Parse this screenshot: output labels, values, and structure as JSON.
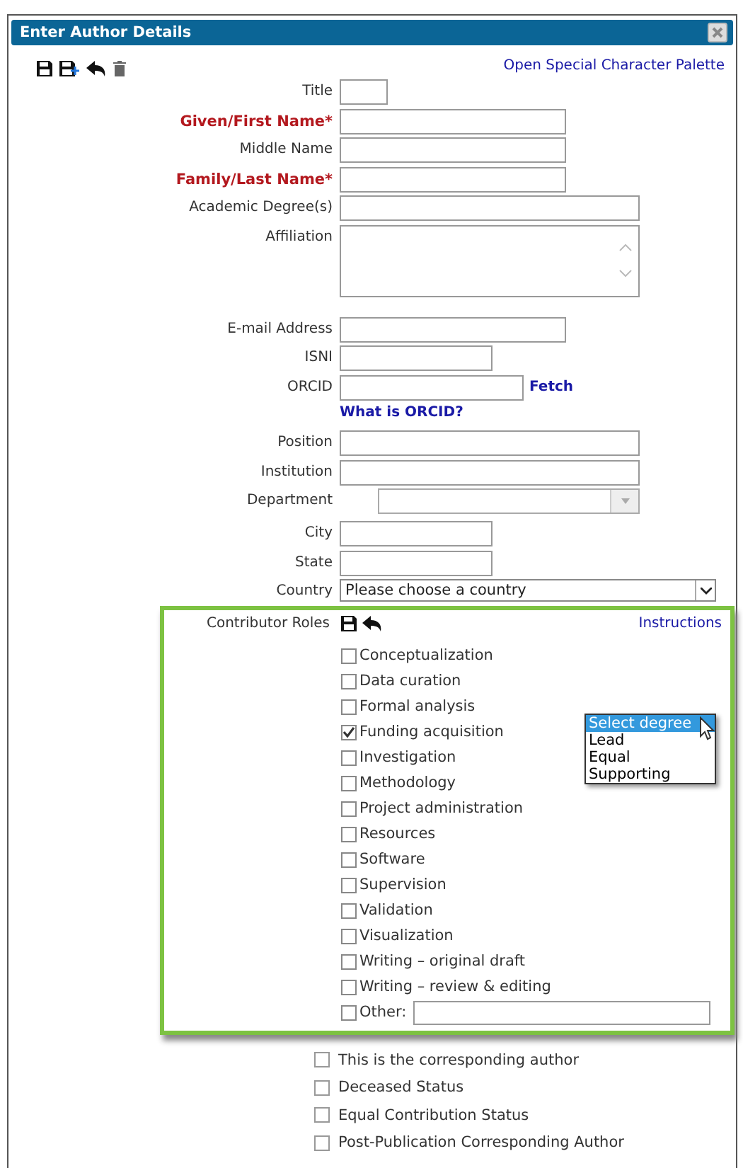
{
  "window": {
    "title": "Enter Author Details"
  },
  "toolbar_link": "Open Special Character Palette",
  "fields": [
    {
      "kind": "text",
      "label": "Title",
      "required": false
    },
    {
      "kind": "text",
      "label": "Given/First Name*",
      "required": true
    },
    {
      "kind": "text",
      "label": "Middle Name",
      "required": false
    },
    {
      "kind": "text",
      "label": "Family/Last Name*",
      "required": true
    },
    {
      "kind": "text",
      "label": "Academic Degree(s)",
      "required": false
    },
    {
      "kind": "textarea",
      "label": "Affiliation",
      "required": false
    },
    {
      "kind": "text",
      "label": "E-mail Address",
      "required": false
    },
    {
      "kind": "text",
      "label": "ISNI",
      "required": false
    },
    {
      "kind": "orcid",
      "label": "ORCID",
      "required": false,
      "link": "Fetch",
      "help": "What is ORCID?"
    },
    {
      "kind": "text",
      "label": "Position",
      "required": false
    },
    {
      "kind": "text",
      "label": "Institution",
      "required": false
    },
    {
      "kind": "combo",
      "label": "Department",
      "required": false
    },
    {
      "kind": "text",
      "label": "City",
      "required": false
    },
    {
      "kind": "text",
      "label": "State",
      "required": false
    },
    {
      "kind": "select",
      "label": "Country",
      "required": false,
      "value": "Please choose a country"
    }
  ],
  "contributor_roles": {
    "label": "Contributor Roles",
    "link": "Instructions",
    "roles": [
      {
        "label": "Conceptualization",
        "checked": false
      },
      {
        "label": "Data curation",
        "checked": false
      },
      {
        "label": "Formal analysis",
        "checked": false
      },
      {
        "label": "Funding acquisition",
        "checked": true,
        "degree_list": {
          "options": [
            {
              "label": "Select degree",
              "selected": true
            },
            {
              "label": "Lead",
              "selected": false
            },
            {
              "label": "Equal",
              "selected": false
            },
            {
              "label": "Supporting",
              "selected": false
            }
          ]
        }
      },
      {
        "label": "Investigation",
        "checked": false
      },
      {
        "label": "Methodology",
        "checked": false
      },
      {
        "label": "Project administration",
        "checked": false
      },
      {
        "label": "Resources",
        "checked": false
      },
      {
        "label": "Software",
        "checked": false
      },
      {
        "label": "Supervision",
        "checked": false
      },
      {
        "label": "Validation",
        "checked": false
      },
      {
        "label": "Visualization",
        "checked": false
      },
      {
        "label": "Writing – original draft",
        "checked": false
      },
      {
        "label": "Writing – review & editing",
        "checked": false
      },
      {
        "label": "Other:",
        "checked": false,
        "kind": "other"
      }
    ]
  },
  "status_options": [
    {
      "label": "This is the corresponding author",
      "checked": false
    },
    {
      "label": "Deceased Status",
      "checked": false
    },
    {
      "label": "Equal Contribution Status",
      "checked": false
    },
    {
      "label": "Post-Publication Corresponding Author",
      "checked": false
    }
  ]
}
